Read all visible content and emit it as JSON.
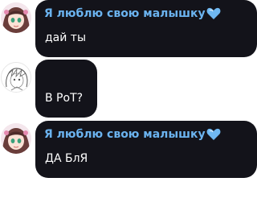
{
  "messages": [
    {
      "sender": "Я люблю свою малышку",
      "sender_emoji": "blue-heart",
      "text": "дай ты",
      "avatar": "anime-girl-avatar"
    },
    {
      "sender": "",
      "text": "В РоТ?",
      "avatar": "sketch-avatar"
    },
    {
      "sender": "Я люблю свою малышку",
      "sender_emoji": "blue-heart",
      "text": "ДА БлЯ",
      "avatar": "anime-girl-avatar"
    }
  ],
  "colors": {
    "bubble": "#13131a",
    "sender_name": "#6bb3ef",
    "message_text": "#ffffff",
    "heart": "#6fb8f2",
    "background": "#ffffff"
  }
}
